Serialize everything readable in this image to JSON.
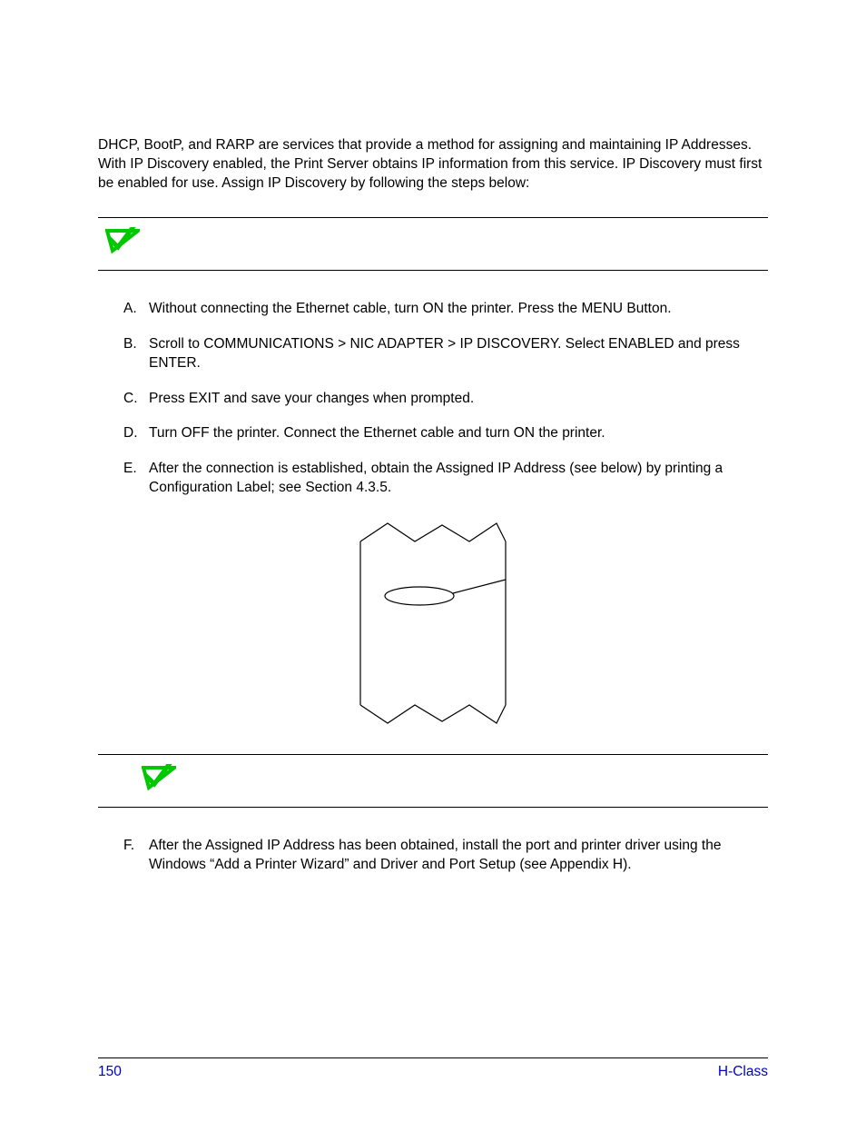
{
  "intro": "DHCP, BootP, and RARP are services that provide a method for assigning and maintaining IP Addresses. With IP Discovery enabled, the Print Server obtains IP information from this service. IP Discovery must first be enabled for use. Assign IP Discovery by following the steps below:",
  "steps": [
    {
      "letter": "A.",
      "text": "Without connecting the Ethernet cable, turn ON the printer. Press the MENU Button."
    },
    {
      "letter": "B.",
      "text": "Scroll to COMMUNICATIONS > NIC ADAPTER > IP DISCOVERY. Select ENABLED and press ENTER."
    },
    {
      "letter": "C.",
      "text": "Press EXIT and save your changes when prompted."
    },
    {
      "letter": "D.",
      "text": "Turn OFF the printer. Connect the Ethernet cable and turn ON the printer."
    },
    {
      "letter": "E.",
      "text": "After the connection is established, obtain the Assigned IP Address (see below) by printing a Configuration Label; see Section 4.3.5."
    }
  ],
  "step_f": {
    "letter": "F.",
    "text": "After the Assigned IP Address has been obtained, install the port and printer driver using the Windows  “Add a Printer Wizard” and Driver and Port Setup (see Appendix H)."
  },
  "footer": {
    "page": "150",
    "model": "H-Class"
  }
}
